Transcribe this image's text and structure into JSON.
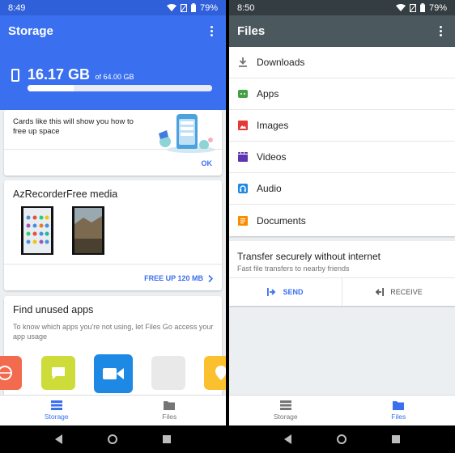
{
  "left": {
    "status": {
      "time": "8:49",
      "battery": "79%"
    },
    "appbar": {
      "title": "Storage"
    },
    "storage": {
      "used": "16.17 GB",
      "total": "of 64.00 GB",
      "used_fraction": 0.25
    },
    "tip_card": {
      "text": "Cards like this will show you how to free up space",
      "ok_label": "OK"
    },
    "media_card": {
      "title": "AzRecorderFree media",
      "action_label": "FREE UP 120 MB"
    },
    "unused_card": {
      "title": "Find unused apps",
      "description": "To know which apps you're not using, let Files Go access your app usage"
    },
    "nav": {
      "storage_label": "Storage",
      "files_label": "Files"
    }
  },
  "right": {
    "status": {
      "time": "8:50",
      "battery": "79%"
    },
    "appbar": {
      "title": "Files"
    },
    "files": [
      {
        "label": "Downloads",
        "icon": "download-icon",
        "color": "#757575"
      },
      {
        "label": "Apps",
        "icon": "android-icon",
        "color": "#43a047"
      },
      {
        "label": "Images",
        "icon": "image-icon",
        "color": "#e53935"
      },
      {
        "label": "Videos",
        "icon": "video-icon",
        "color": "#5e35b1"
      },
      {
        "label": "Audio",
        "icon": "headphones-icon",
        "color": "#1e88e5"
      },
      {
        "label": "Documents",
        "icon": "document-icon",
        "color": "#fb8c00"
      }
    ],
    "transfer": {
      "title": "Transfer securely without internet",
      "description": "Fast file transfers to nearby friends",
      "send_label": "SEND",
      "receive_label": "RECEIVE"
    },
    "nav": {
      "storage_label": "Storage",
      "files_label": "Files"
    }
  },
  "colors": {
    "accent": "#3a6ff0",
    "storage_header": "#3a6ff0",
    "files_header": "#4b585e"
  }
}
